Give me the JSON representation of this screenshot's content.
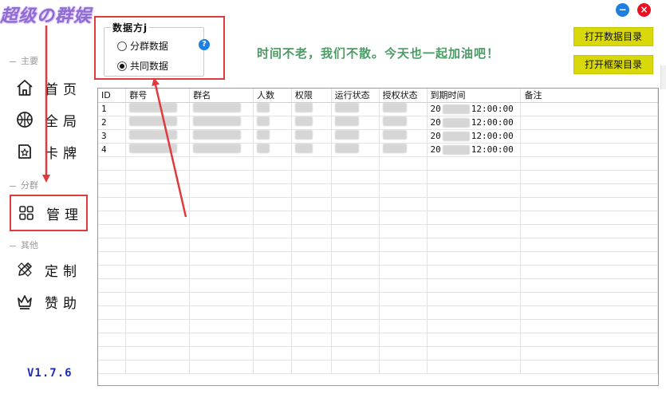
{
  "app": {
    "title": "超级の群娱",
    "version": "V1.7.6"
  },
  "sidebar": {
    "sections": [
      {
        "label": "主要"
      },
      {
        "label": "分群"
      },
      {
        "label": "其他"
      }
    ],
    "items": [
      {
        "label": "首页",
        "icon": "home-icon"
      },
      {
        "label": "全局",
        "icon": "basketball-icon"
      },
      {
        "label": "卡牌",
        "icon": "card-icon"
      },
      {
        "label": "管理",
        "icon": "grid-icon"
      },
      {
        "label": "定制",
        "icon": "pencil-ruler-icon"
      },
      {
        "label": "赞助",
        "icon": "crown-icon"
      }
    ]
  },
  "mode": {
    "legend": "数据方j",
    "help": "?",
    "options": [
      {
        "label": "分群数据",
        "checked": false
      },
      {
        "label": "共同数据",
        "checked": true
      }
    ]
  },
  "slogan": "时间不老，我们不散。今天也一起加油吧！",
  "buttons": {
    "open_data_dir": "打开数据目录",
    "open_frame_dir": "打开框架目录"
  },
  "window": {
    "minimize": "−",
    "close": "×"
  },
  "table": {
    "columns": [
      "ID",
      "群号",
      "群名",
      "人数",
      "权限",
      "运行状态",
      "授权状态",
      "到期时间",
      "备注"
    ],
    "rows": [
      {
        "id": "1",
        "expiry_prefix": "20",
        "expiry_suffix": "12:00:00"
      },
      {
        "id": "2",
        "expiry_prefix": "20",
        "expiry_suffix": "12:00:00"
      },
      {
        "id": "3",
        "expiry_prefix": "20",
        "expiry_suffix": "12:00:00"
      },
      {
        "id": "4",
        "expiry_prefix": "20",
        "expiry_suffix": "12:00:00"
      }
    ]
  },
  "colors": {
    "highlight": "#e0393e",
    "button": "#d8d80a",
    "slogan": "#4a9b64",
    "version": "#1c2db8",
    "minimize": "#1f7fe0",
    "close": "#e81123"
  }
}
